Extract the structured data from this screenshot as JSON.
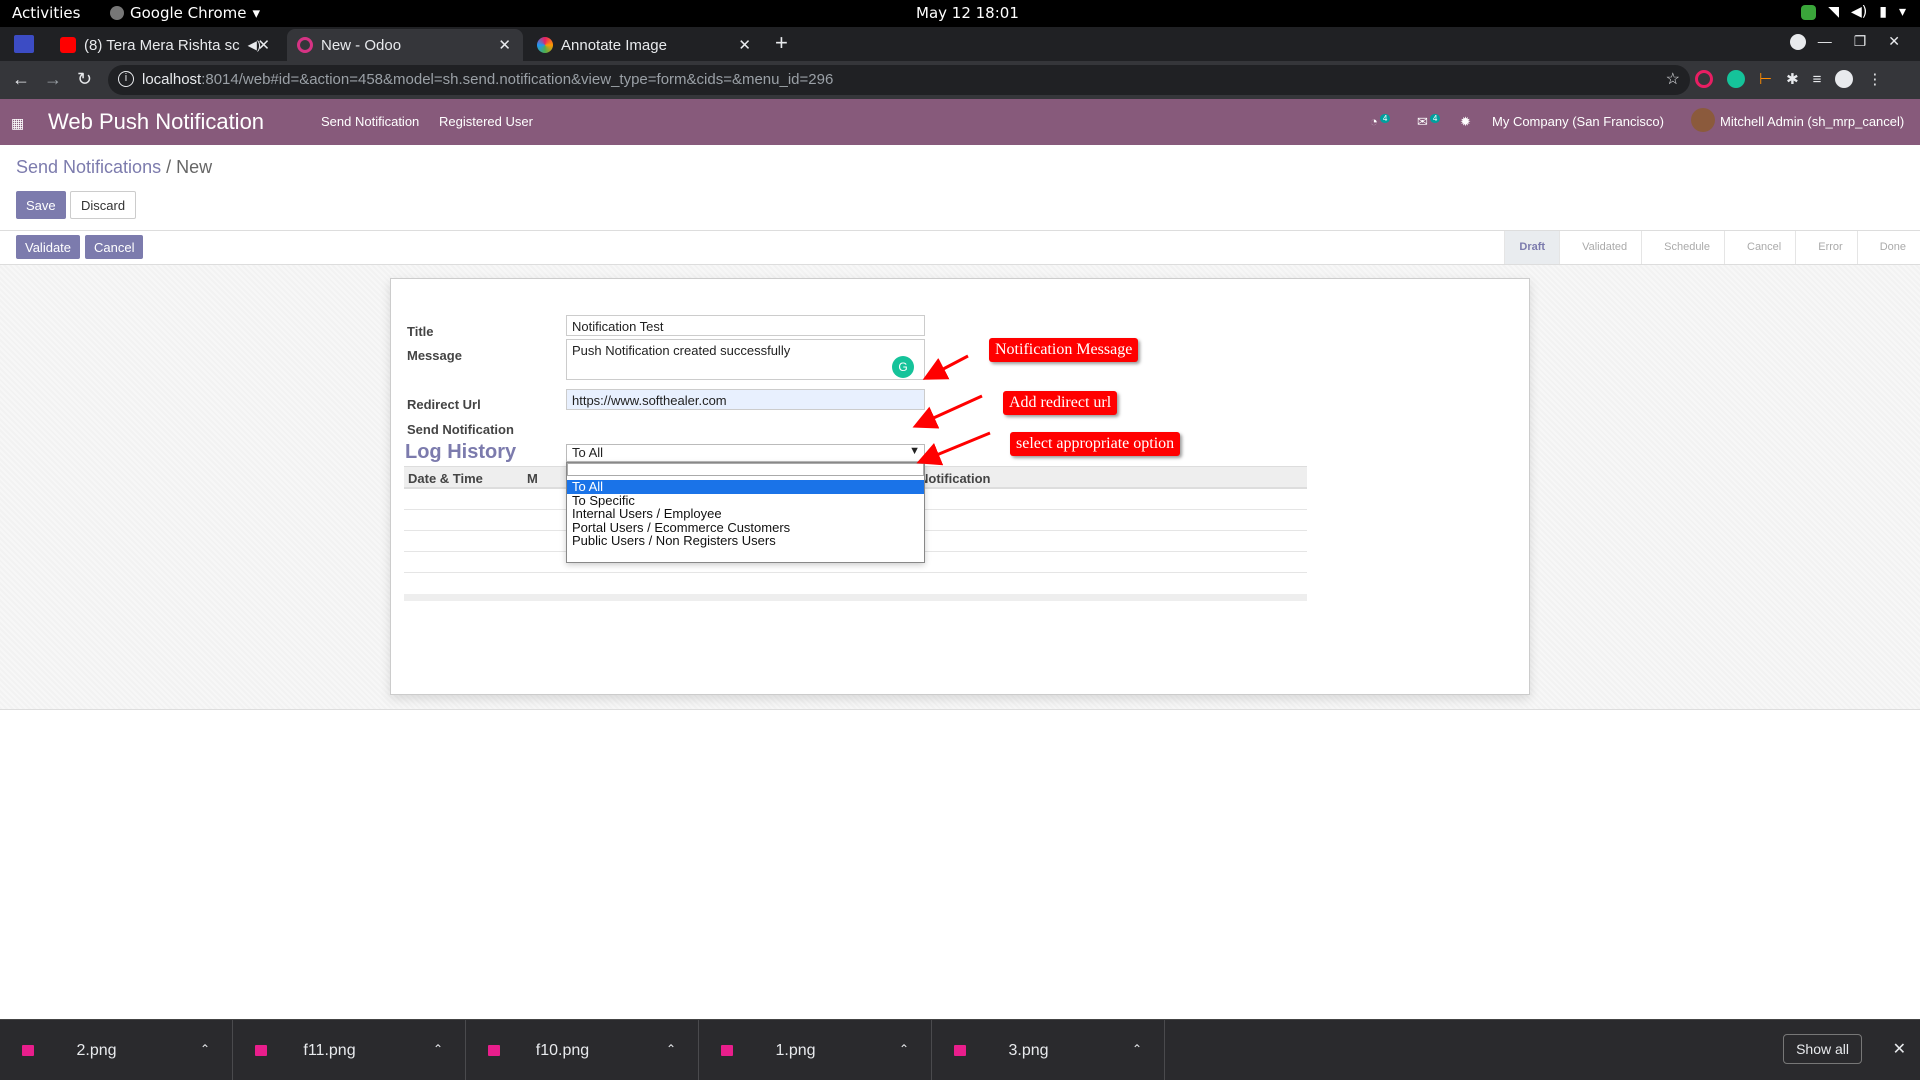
{
  "system": {
    "activities": "Activities",
    "app_name": "Google Chrome",
    "clock": "May 12  18:01"
  },
  "browser": {
    "tabs": [
      {
        "title": "(8) Tera Mera Rishta sc"
      },
      {
        "title": "New - Odoo"
      },
      {
        "title": "Annotate Image"
      }
    ],
    "url_host": "localhost",
    "url_rest": ":8014/web#id=&action=458&model=sh.send.notification&view_type=form&cids=&menu_id=296"
  },
  "odoo": {
    "app_title": "Web Push Notification",
    "menu": [
      "Send Notification",
      "Registered User"
    ],
    "activity_count": "4",
    "message_count": "4",
    "company": "My Company (San Francisco)",
    "user": "Mitchell Admin (sh_mrp_cancel)"
  },
  "control_panel": {
    "breadcrumb_parent": "Send Notifications",
    "breadcrumb_sep": "/",
    "breadcrumb_current": "New",
    "save": "Save",
    "discard": "Discard"
  },
  "statusbar": {
    "validate": "Validate",
    "cancel": "Cancel",
    "stages": [
      "Draft",
      "Validated",
      "Schedule",
      "Cancel",
      "Error",
      "Done"
    ],
    "current_stage": "Draft"
  },
  "form": {
    "title_label": "Title",
    "title_value": "Notification Test",
    "message_label": "Message",
    "message_value": "Push Notification created successfully",
    "redirect_label": "Redirect Url",
    "redirect_value": "https://www.softhealer.com",
    "send_label": "Send Notification",
    "send_value": "To All",
    "send_options": [
      "To All",
      "To Specific",
      "Internal Users / Employee",
      "Portal Users / Ecommerce Customers",
      "Public Users / Non Registers Users"
    ],
    "log_title": "Log History",
    "log_columns": [
      "Date & Time",
      "M",
      "Notification"
    ]
  },
  "annotations": {
    "message": "Notification Message",
    "redirect": "Add redirect url",
    "option": "select appropriate option"
  },
  "downloads": {
    "files": [
      "2.png",
      "f11.png",
      "f10.png",
      "1.png",
      "3.png"
    ],
    "show_all": "Show all"
  },
  "colors": {
    "odoo_primary": "#875a7b",
    "odoo_button": "#7c7bad",
    "annotation": "#ff0000"
  }
}
